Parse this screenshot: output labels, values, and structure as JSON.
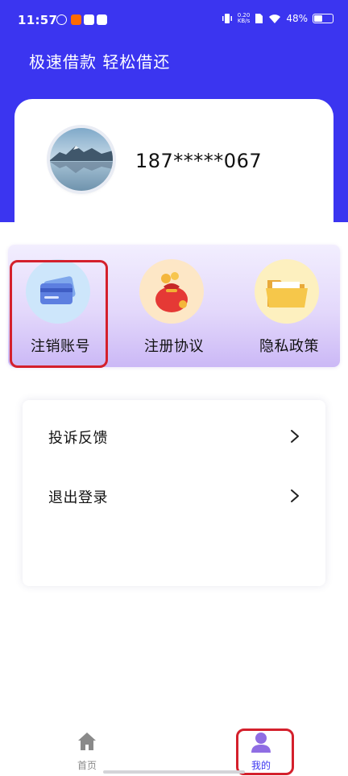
{
  "status_bar": {
    "time": "11:57",
    "net_speed_value": "0.20",
    "net_speed_unit": "KB/s",
    "battery_percent": "48%",
    "battery_level": 0.48
  },
  "header": {
    "title": "极速借款 轻松借还"
  },
  "profile": {
    "phone": "187*****067"
  },
  "services": [
    {
      "label": "注销账号",
      "icon": "credit-card-icon"
    },
    {
      "label": "注册协议",
      "icon": "money-bag-icon"
    },
    {
      "label": "隐私政策",
      "icon": "folder-icon"
    }
  ],
  "menu": [
    {
      "label": "投诉反馈"
    },
    {
      "label": "退出登录"
    }
  ],
  "chevron": ">",
  "tabbar": {
    "home": {
      "label": "首页"
    },
    "mine": {
      "label": "我的"
    }
  },
  "colors": {
    "brand": "#3b35f0",
    "highlight": "#d4202c",
    "active_tab": "#3b35f0",
    "inactive_tab": "#8a8a8a"
  }
}
